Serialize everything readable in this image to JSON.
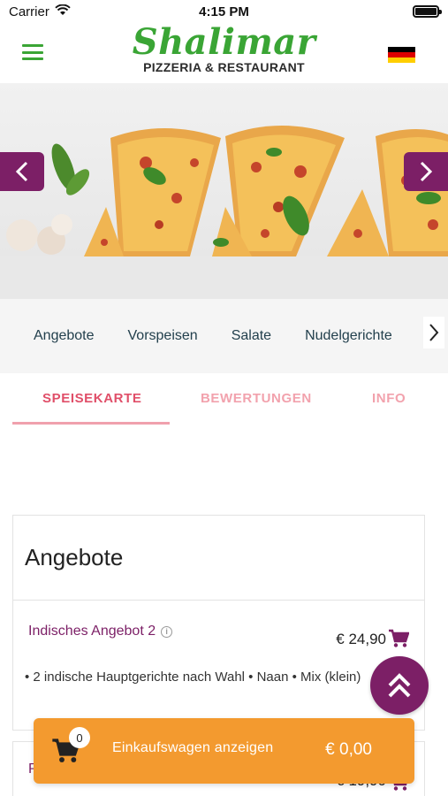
{
  "status_bar": {
    "carrier": "Carrier",
    "time": "4:15 PM"
  },
  "header": {
    "logo_name": "Shalimar",
    "logo_subtitle": "PIZZERIA & RESTAURANT"
  },
  "banner": {
    "prev_icon": "chevron-left-icon",
    "next_icon": "chevron-right-icon"
  },
  "categories": {
    "items": [
      "Angebote",
      "Vorspeisen",
      "Salate",
      "Nudelgerichte"
    ],
    "next_icon": "chevron-right-icon"
  },
  "tabs": [
    {
      "label": "SPEISEKARTE",
      "active": true
    },
    {
      "label": "BEWERTUNGEN",
      "active": false
    },
    {
      "label": "INFO",
      "active": false
    }
  ],
  "menu": {
    "section_title": "Angebote",
    "item": {
      "name": "Indisches Angebot 2",
      "price": "€ 24,90",
      "description": "• 2 indische Hauptgerichte nach Wahl • Naan • Mix (klein)"
    },
    "next_item_name": "P",
    "next_item_price": "€ 19,90"
  },
  "cart": {
    "count": "0",
    "label": "Einkaufswagen anzeigen",
    "total": "€ 0,00"
  },
  "colors": {
    "brand_green": "#3aa535",
    "brand_purple": "#7c1f66",
    "tab_active": "#e04f69",
    "cart_orange": "#f39a2f"
  }
}
